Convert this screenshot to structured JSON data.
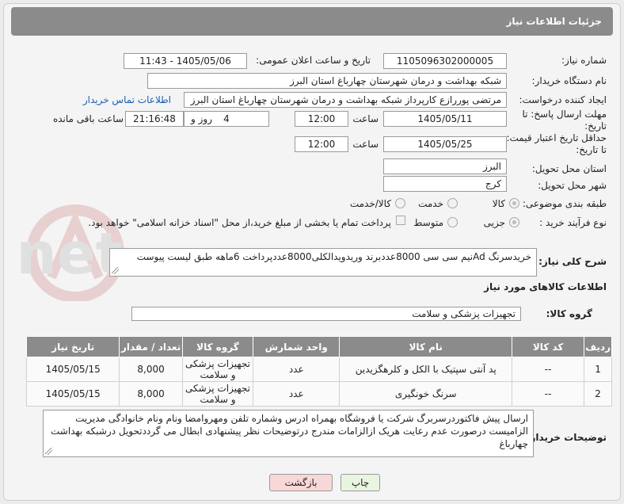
{
  "header": {
    "title": "جزئیات اطلاعات نیاز"
  },
  "fields": {
    "need_number_label": "شماره نیاز:",
    "need_number": "1105096302000005",
    "announce_label": "تاریخ و ساعت اعلان عمومی:",
    "announce_value": "1405/05/06 - 11:43",
    "buyer_org_label": "نام دستگاه خریدار:",
    "buyer_org": "شبکه بهداشت و درمان شهرستان چهارباغ استان البرز",
    "creator_label": "ایجاد کننده درخواست:",
    "creator": "مرتضی پوررازع کارپرداز شبکه بهداشت و درمان شهرستان چهارباغ استان البرز",
    "contact_link": "اطلاعات تماس خریدار",
    "deadline_label": "مهلت ارسال پاسخ: تا تاریخ:",
    "deadline_date": "1405/05/11",
    "time_label": "ساعت",
    "deadline_time": "12:00",
    "days_count": "4",
    "days_label": "روز و",
    "remaining_time": "21:16:48",
    "remaining_label": "ساعت باقی مانده",
    "validity_label": "حداقل تاریخ اعتبار قیمت: تا تاریخ:",
    "validity_date": "1405/05/25",
    "validity_time": "12:00",
    "province_label": "استان محل تحویل:",
    "province": "البرز",
    "city_label": "شهر محل تحویل:",
    "city": "کرج",
    "category_label": "طبقه بندی موضوعی:",
    "cat_goods": "کالا",
    "cat_service": "خدمت",
    "cat_goods_service": "کالا/خدمت",
    "process_label": "نوع فرآیند خرید :",
    "proc_partial": "جزیی",
    "proc_medium": "متوسط",
    "payment_note": "پرداخت تمام یا بخشی از مبلغ خرید،از محل \"اسناد خزانه اسلامی\" خواهد بود.",
    "summary_label": "شرح کلی نیاز:",
    "summary": "خریدسرنگ Adنیم سی سی 8000عددبرند وریدویدالکلی8000عددپرداخت 6ماهه طبق لیست پیوست",
    "goods_info_title": "اطلاعات کالاهای مورد نیاز",
    "goods_group_label": "گروه کالا:",
    "goods_group": "تجهیزات پزشکی و سلامت",
    "buyer_notes_label": "توضیحات خریدار:",
    "buyer_notes": "ارسال پیش فاکتوردرسربرگ شرکت یا فروشگاه بهمراه ادرس وشماره تلفن ومهروامضا ونام ونام خانوادگی مدیریت الزامیست درصورت عدم رعایت هریک ازالزامات مندرج درتوضیحات نظر پیشنهادی ابطال می گرددتحویل درشبکه بهداشت چهارباغ"
  },
  "table": {
    "headers": [
      "ردیف",
      "کد کالا",
      "نام کالا",
      "واحد شمارش",
      "گروه کالا",
      "تعداد / مقدار",
      "تاریخ نیاز"
    ],
    "rows": [
      [
        "1",
        "--",
        "پد آنتی سپتیک با الکل و کلرهگزیدین",
        "عدد",
        "تجهیزات پزشکی و سلامت",
        "8,000",
        "1405/05/15"
      ],
      [
        "2",
        "--",
        "سرنگ خونگیری",
        "عدد",
        "تجهیزات پزشکی و سلامت",
        "8,000",
        "1405/05/15"
      ]
    ]
  },
  "buttons": {
    "print": "چاپ",
    "back": "بازگشت"
  },
  "watermark": {
    "text": "AriaTender.net"
  },
  "colors": {
    "header_bg": "#8b8b8b",
    "link": "#1a5fb4",
    "back_btn": "#f8d7d7",
    "print_btn": "#e8f5e0"
  },
  "icons": {
    "resize": "resize-grip-icon",
    "logo": "aria-logo-icon"
  }
}
